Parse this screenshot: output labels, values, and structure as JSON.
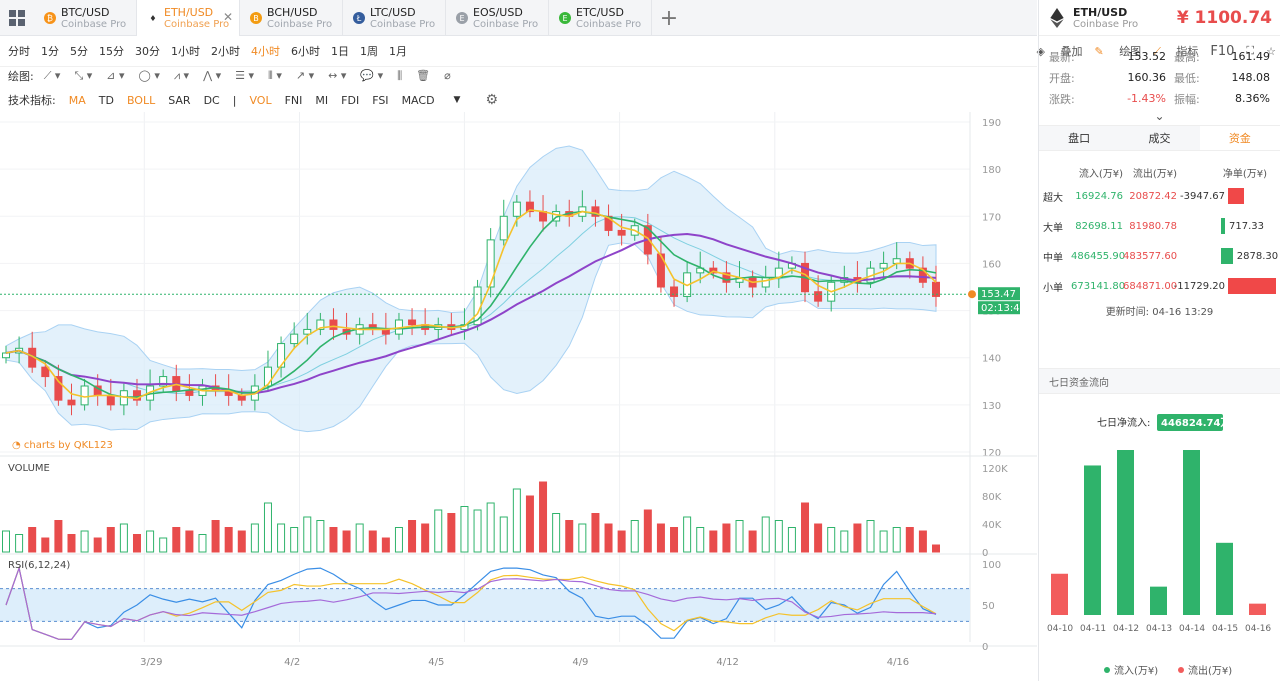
{
  "tabs": [
    {
      "pair": "BTC/USD",
      "exchange": "Coinbase Pro",
      "icon": "btc-icon",
      "color": "#f7931a",
      "glyph": "₿"
    },
    {
      "pair": "ETH/USD",
      "exchange": "Coinbase Pro",
      "icon": "eth-icon",
      "color": "#444444",
      "glyph": "♦",
      "active": true
    },
    {
      "pair": "BCH/USD",
      "exchange": "Coinbase Pro",
      "icon": "bch-icon",
      "color": "#f39c12",
      "glyph": "B"
    },
    {
      "pair": "LTC/USD",
      "exchange": "Coinbase Pro",
      "icon": "ltc-icon",
      "color": "#345d9d",
      "glyph": "Ł"
    },
    {
      "pair": "EOS/USD",
      "exchange": "Coinbase Pro",
      "icon": "eos-icon",
      "color": "#9aa0a8",
      "glyph": "E"
    },
    {
      "pair": "ETC/USD",
      "exchange": "Coinbase Pro",
      "icon": "etc-icon",
      "color": "#3ab83a",
      "glyph": "E"
    }
  ],
  "periods": [
    "分时",
    "1分",
    "5分",
    "15分",
    "30分",
    "1小时",
    "2小时",
    "4小时",
    "6小时",
    "1日",
    "1周",
    "1月"
  ],
  "active_period": "4小时",
  "right_tools": {
    "overlay": "叠加",
    "draw": "绘图",
    "indicator": "指标",
    "f10": "F10"
  },
  "draw_label": "绘图:",
  "indicator_label": "技术指标:",
  "indicators": [
    {
      "name": "MA",
      "on": true
    },
    {
      "name": "TD",
      "on": false
    },
    {
      "name": "BOLL",
      "on": true
    },
    {
      "name": "SAR",
      "on": false
    },
    {
      "name": "DC",
      "on": false
    },
    {
      "name": "|",
      "on": false
    },
    {
      "name": "VOL",
      "on": true
    },
    {
      "name": "FNI",
      "on": false
    },
    {
      "name": "MI",
      "on": false
    },
    {
      "name": "FDI",
      "on": false
    },
    {
      "name": "FSI",
      "on": false
    },
    {
      "name": "MACD",
      "on": false
    }
  ],
  "watermark": "charts by QKL123",
  "volume_label": "VOLUME",
  "rsi_label": "RSI(6,12,24)",
  "price_axis": [
    "190",
    "180",
    "170",
    "160",
    "150",
    "140",
    "130",
    "120"
  ],
  "volume_axis": [
    "120K",
    "80K",
    "40K",
    "0"
  ],
  "rsi_axis": [
    "100",
    "50",
    "0"
  ],
  "date_labels": [
    "3/29",
    "4/2",
    "4/5",
    "4/9",
    "4/12",
    "4/16"
  ],
  "last_price_tag": "153.47",
  "countdown_tag": "02:13:44",
  "side": {
    "pair": "ETH/USD",
    "exchange": "Coinbase Pro",
    "price": "¥ 1100.74",
    "stats": [
      {
        "k": "最新:",
        "v": "153.52",
        "k2": "最高:",
        "v2": "161.49"
      },
      {
        "k": "开盘:",
        "v": "160.36",
        "k2": "最低:",
        "v2": "148.08"
      },
      {
        "k": "涨跌:",
        "v": "-1.43%",
        "k2": "振幅:",
        "v2": "8.36%"
      }
    ],
    "tabs": [
      "盘口",
      "成交",
      "资金"
    ],
    "active_tab": "资金",
    "flow_headers": [
      "流入(万¥)",
      "流出(万¥)",
      "净单(万¥)"
    ],
    "flows": [
      {
        "label": "超大",
        "in": "16924.76",
        "out": "20872.42",
        "net": "-3947.67",
        "net_value": -3947.67
      },
      {
        "label": "大单",
        "in": "82698.11",
        "out": "81980.78",
        "net": "717.33",
        "net_value": 717.33
      },
      {
        "label": "中单",
        "in": "486455.90",
        "out": "483577.60",
        "net": "2878.30",
        "net_value": 2878.3
      },
      {
        "label": "小单",
        "in": "673141.80",
        "out": "684871.00",
        "net": "-11729.20",
        "net_value": -11729.2
      }
    ],
    "updated": "更新时间: 04-16 13:29",
    "seven_day_title": "七日资金流向",
    "seven_day_net_label": "七日净流入:",
    "seven_day_net": "446824.74万",
    "legend_in": "流入(万¥)",
    "legend_out": "流出(万¥)"
  },
  "chart_data": [
    {
      "type": "candlestick",
      "title": "",
      "yrange": [
        120,
        190
      ],
      "grid": true,
      "x_labels": [
        "3/29",
        "4/2",
        "4/5",
        "4/9",
        "4/12",
        "4/16"
      ],
      "approx_close": [
        141,
        142,
        138,
        136,
        131,
        130,
        134,
        132,
        130,
        133,
        131,
        134,
        136,
        133,
        132,
        134,
        133,
        132,
        131,
        134,
        138,
        143,
        145,
        146,
        148,
        146,
        145,
        147,
        146,
        145,
        148,
        147,
        146,
        147,
        146,
        147,
        155,
        165,
        170,
        173,
        171,
        169,
        171,
        170,
        172,
        170,
        167,
        166,
        168,
        162,
        155,
        153,
        158,
        159,
        158,
        156,
        157,
        155,
        157,
        159,
        160,
        154,
        152,
        156,
        157,
        156,
        159,
        160,
        161,
        159,
        156,
        153
      ],
      "overlays": [
        "MA (yellow)",
        "MA (green)",
        "MA (purple)",
        "BOLL band (light blue)"
      ],
      "last_price": 153.47
    },
    {
      "type": "bar",
      "title": "VOLUME",
      "yrange": [
        0,
        120000
      ],
      "approx_values_k": [
        30,
        25,
        35,
        20,
        45,
        25,
        30,
        20,
        35,
        40,
        25,
        30,
        20,
        35,
        30,
        25,
        45,
        35,
        30,
        40,
        70,
        40,
        35,
        50,
        45,
        35,
        30,
        40,
        30,
        20,
        35,
        45,
        40,
        60,
        55,
        65,
        60,
        70,
        50,
        90,
        80,
        100,
        55,
        45,
        40,
        55,
        40,
        30,
        45,
        60,
        40,
        35,
        50,
        35,
        30,
        40,
        45,
        30,
        50,
        45,
        35,
        70,
        40,
        35,
        30,
        40,
        45,
        30,
        35,
        35,
        30,
        10
      ],
      "colors": {
        "up": "#2fb36b",
        "down": "#e84c4c"
      }
    },
    {
      "type": "line",
      "title": "RSI(6,12,24)",
      "yrange": [
        0,
        100
      ],
      "reference_lines": [
        30,
        70
      ]
    },
    {
      "type": "bar",
      "title": "七日资金流向",
      "categories": [
        "04-10",
        "04-11",
        "04-12",
        "04-13",
        "04-14",
        "04-15",
        "04-16"
      ],
      "values": [
        -8,
        29,
        32,
        5.5,
        32,
        14,
        -2.2
      ],
      "series_legend": [
        "流入(万¥)",
        "流出(万¥)"
      ]
    }
  ]
}
